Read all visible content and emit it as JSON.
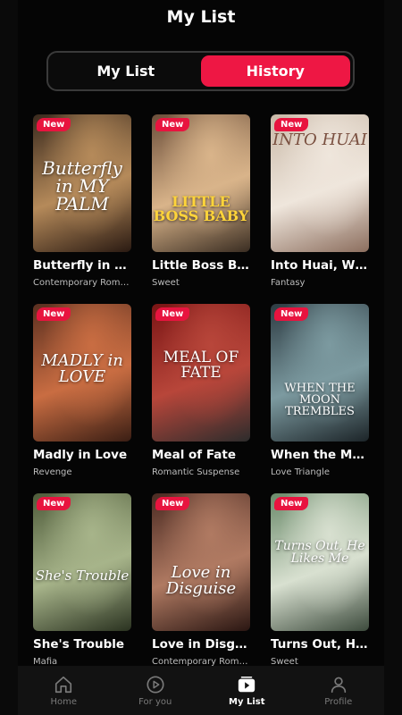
{
  "header": {
    "title": "My List"
  },
  "tabs": [
    {
      "label": "My List",
      "active": false
    },
    {
      "label": "History",
      "active": true
    }
  ],
  "cards": [
    {
      "title": "Butterfly in My...",
      "genre": "Contemporary Roma...",
      "badge": "New",
      "art": "Butterfly in MY PALM",
      "colors": [
        "#3a2a1e",
        "#b58a5a",
        "#2a1a12"
      ]
    },
    {
      "title": "Little Boss Baby",
      "genre": "Sweet",
      "badge": "New",
      "art": "LITTLE BOSS BABY",
      "colors": [
        "#6b4e3a",
        "#d9b48a",
        "#3a2d22"
      ]
    },
    {
      "title": "Into Huai, With...",
      "genre": "Fantasy",
      "badge": "New",
      "art": "INTO HUAI",
      "colors": [
        "#c9b9a8",
        "#efe6dc",
        "#8c6e5e"
      ]
    },
    {
      "title": "Madly in Love",
      "genre": "Revenge",
      "badge": "New",
      "art": "MADLY in LOVE",
      "colors": [
        "#5a2f20",
        "#c96d42",
        "#3a1e14"
      ]
    },
    {
      "title": "Meal of Fate",
      "genre": "Romantic Suspense",
      "badge": "New",
      "art": "MEAL OF FATE",
      "colors": [
        "#7a1515",
        "#b8463a",
        "#2c2c2c"
      ]
    },
    {
      "title": "When the Moo...",
      "genre": "Love Triangle",
      "badge": "New",
      "art": "WHEN THE MOON TREMBLES",
      "colors": [
        "#2d3b42",
        "#7c9aa0",
        "#1c2428"
      ]
    },
    {
      "title": "She's Trouble",
      "genre": "Mafia",
      "badge": "New",
      "art": "She's Trouble",
      "colors": [
        "#4e5b3a",
        "#a7b48a",
        "#2a3220"
      ]
    },
    {
      "title": "Love in Disguise",
      "genre": "Contemporary Roma...",
      "badge": "New",
      "art": "Love in Disguise",
      "colors": [
        "#4a2a22",
        "#b07a62",
        "#2a1612"
      ]
    },
    {
      "title": "Turns Out, He ...",
      "genre": "Sweet",
      "badge": "New",
      "art": "Turns Out, He Likes Me",
      "colors": [
        "#6a8a6a",
        "#d8e0d0",
        "#3c4a3c"
      ]
    }
  ],
  "nav": [
    {
      "label": "Home",
      "icon": "home-icon",
      "active": false
    },
    {
      "label": "For you",
      "icon": "play-circle-icon",
      "active": false
    },
    {
      "label": "My List",
      "icon": "play-square-icon",
      "active": true
    },
    {
      "label": "Profile",
      "icon": "person-icon",
      "active": false
    }
  ],
  "accent": "#ee1744"
}
